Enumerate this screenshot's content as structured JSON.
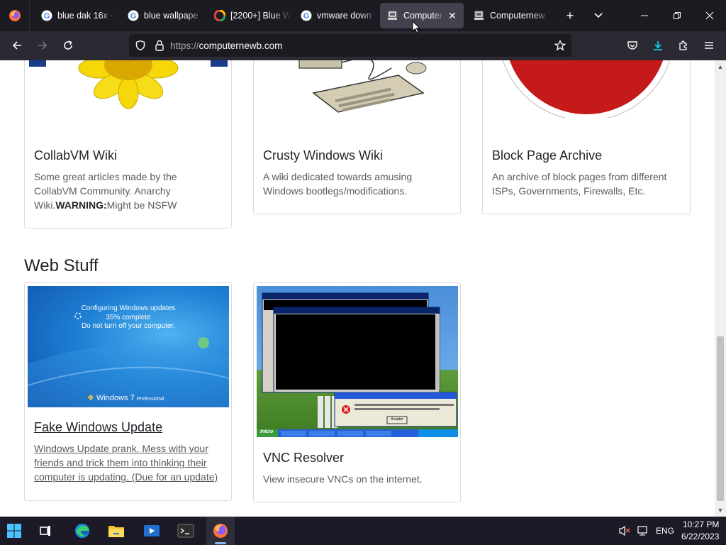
{
  "browser": {
    "tabs": [
      {
        "label": "blue dak 16x -",
        "favicon": "google-icon"
      },
      {
        "label": "blue wallpape",
        "favicon": "google-icon"
      },
      {
        "label": "[2200+] Blue W",
        "favicon": "wallpaper-site-icon"
      },
      {
        "label": "vmware down",
        "favicon": "google-icon"
      },
      {
        "label": "Computer",
        "favicon": "computernewb-icon",
        "active": true
      },
      {
        "label": "Computernew",
        "favicon": "computernewb-icon"
      }
    ],
    "url_protocol": "https://",
    "url_host": "computernewb.com"
  },
  "cards_row1": [
    {
      "title": "CollabVM Wiki",
      "desc_plain": "Some great articles made by the CollabVM Community. Anarchy Wiki.",
      "desc_bold": "WARNING:",
      "desc_tail": "Might be NSFW"
    },
    {
      "title": "Crusty Windows Wiki",
      "desc": "A wiki dedicated towards amusing Windows bootlegs/modifications."
    },
    {
      "title": "Block Page Archive",
      "desc": "An archive of block pages from different ISPs, Governments, Firewalls, Etc."
    }
  ],
  "section_title": "Web Stuff",
  "cards_row2": [
    {
      "title": "Fake Windows Update",
      "desc": "Windows Update prank. Mess with your friends and trick them into thinking their computer is updating. (Due for an update)",
      "screen_line1": "Configuring Windows updates",
      "screen_line2": "35% complete",
      "screen_line3": "Do not turn off your computer.",
      "screen_logo": "Windows 7",
      "screen_edition": "Professional"
    },
    {
      "title": "VNC Resolver",
      "desc": "View insecure VNCs on the internet.",
      "screen_start": "Inicio",
      "screen_button": "Aceptar"
    }
  ],
  "taskbar": {
    "language": "ENG",
    "time": "10:27 PM",
    "date": "6/22/2023"
  }
}
